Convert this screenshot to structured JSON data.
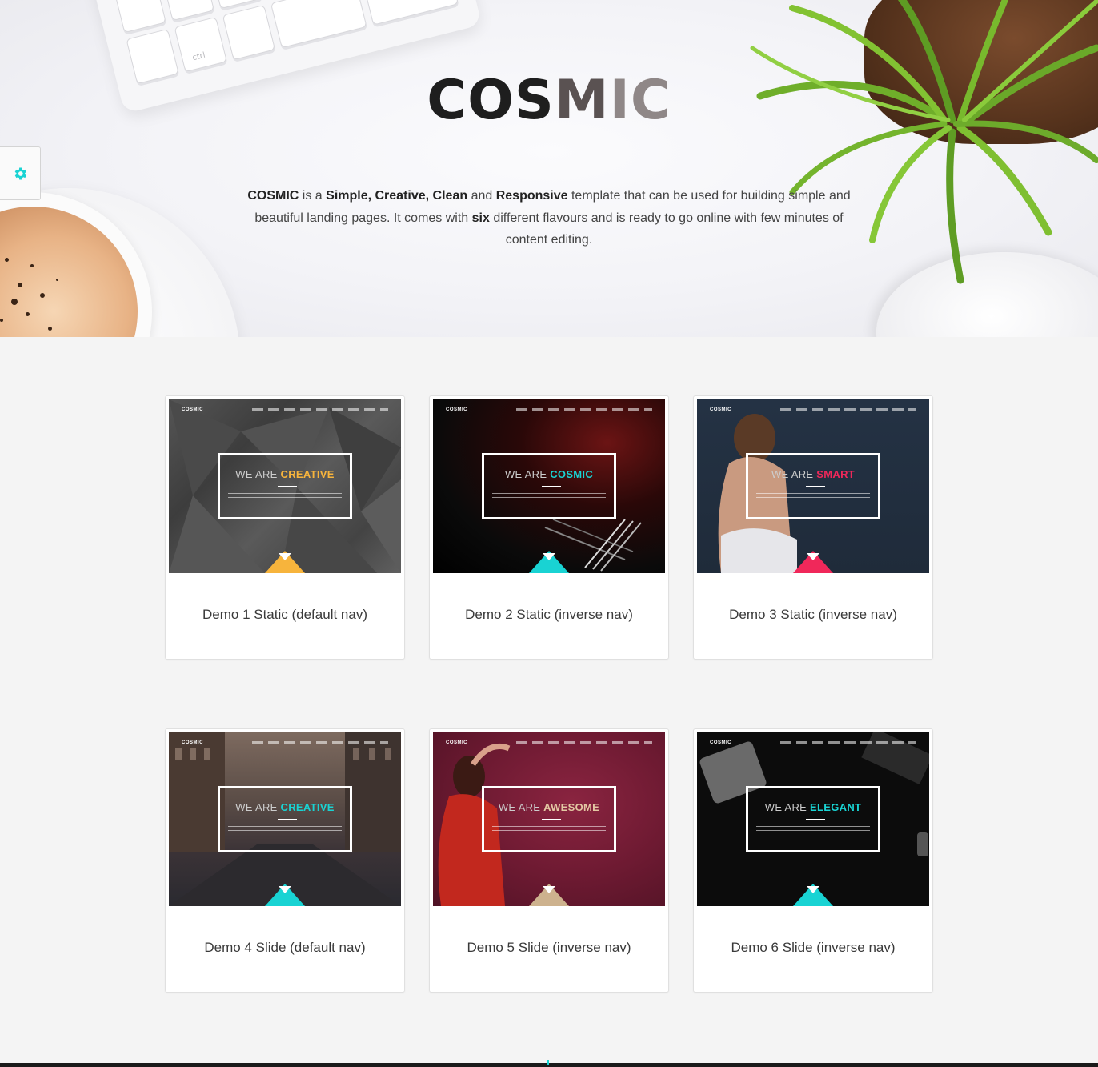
{
  "hero": {
    "title_part1": "COS",
    "title_part2": "M",
    "title_part3": "IC",
    "description": {
      "brand": "COSMIC",
      "t1": " is a ",
      "w_simple": "Simple",
      "t2": ", ",
      "w_creative": "Creative",
      "t3": ", ",
      "w_clean": "Clean",
      "t4": " and ",
      "w_responsive": "Responsive",
      "t5": " template that can be used for building simple and beautiful landing pages. It comes with ",
      "w_six": "six",
      "t6": " different flavours and is ready to go online with few minutes of content editing."
    },
    "keyboard_key_label": "ctrl"
  },
  "settings": {
    "icon": "gear-icon",
    "color": "#19d3d3"
  },
  "demos": [
    {
      "label": "Demo 1 Static (default nav)",
      "logo": "COSMIC",
      "we": "WE ARE ",
      "accent_word": "CREATIVE",
      "accent": "#f7b43c",
      "bg": "polygon-gray"
    },
    {
      "label": "Demo 2 Static (inverse nav)",
      "logo": "COSMIC",
      "we": "WE ARE ",
      "accent_word": "COSMIC",
      "accent": "#19d3d3",
      "bg": "dark-red-light"
    },
    {
      "label": "Demo 3 Static (inverse nav)",
      "logo": "COSMIC",
      "we": "WE ARE ",
      "accent_word": "SMART",
      "accent": "#f0285a",
      "bg": "navy-portrait"
    },
    {
      "label": "Demo 4 Slide (default nav)",
      "logo": "COSMIC",
      "we": "WE ARE ",
      "accent_word": "CREATIVE",
      "accent": "#19d3d3",
      "bg": "street"
    },
    {
      "label": "Demo 5 Slide (inverse nav)",
      "logo": "COSMIC",
      "we": "WE ARE ",
      "accent_word": "AWESOME",
      "accent": "#e3c8a3",
      "bg": "crimson"
    },
    {
      "label": "Demo 6 Slide (inverse nav)",
      "logo": "COSMIC",
      "we": "WE ARE ",
      "accent_word": "ELEGANT",
      "accent": "#19d3d3",
      "bg": "black-desk"
    }
  ]
}
